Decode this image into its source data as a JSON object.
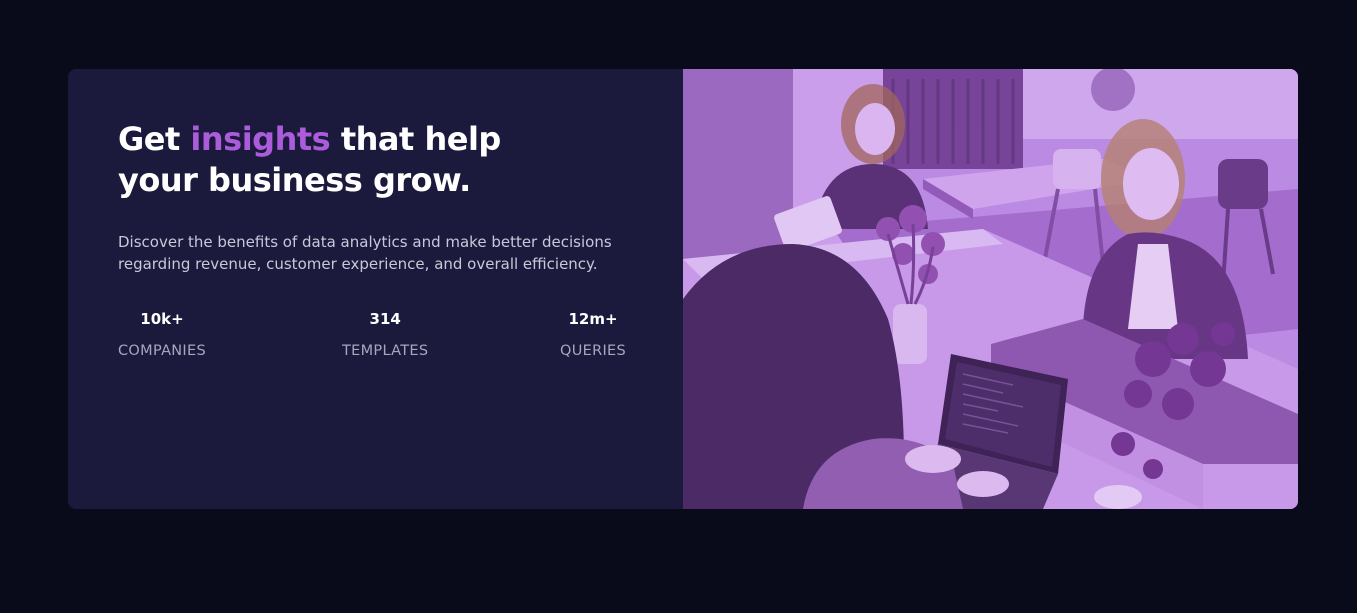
{
  "hero": {
    "headline_before": "Get ",
    "headline_accent": "insights",
    "headline_after": " that help your business grow.",
    "description": "Discover the benefits of data analytics and make better decisions regarding revenue, customer experience, and overall efficiency."
  },
  "stats": [
    {
      "value": "10k+",
      "label": "COMPANIES"
    },
    {
      "value": "314",
      "label": "TEMPLATES"
    },
    {
      "value": "12m+",
      "label": "QUERIES"
    }
  ],
  "colors": {
    "page_background": "#090b1a",
    "card_background": "#1c1a3c",
    "accent": "#aa5cdb",
    "image_tint": "#b57fe0"
  },
  "image": {
    "icon": "office-photo"
  }
}
